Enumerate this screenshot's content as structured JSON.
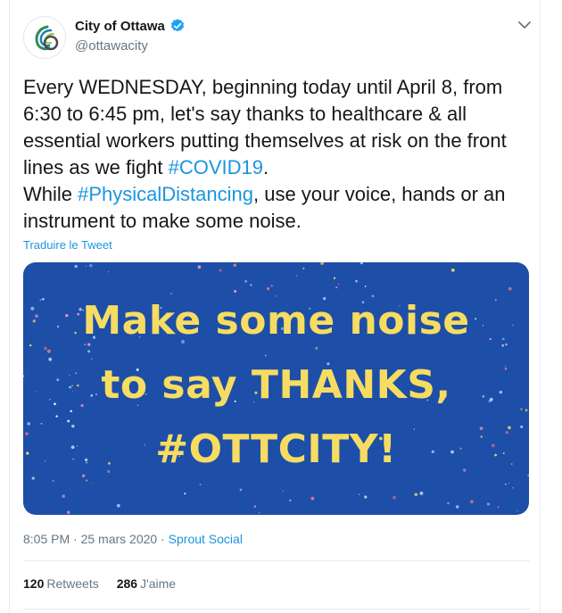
{
  "account": {
    "display_name": "City of Ottawa",
    "handle": "@ottawacity",
    "verified": true
  },
  "tweet": {
    "text_part1": "Every WEDNESDAY, beginning today until April 8, from 6:30 to 6:45 pm, let's say thanks to healthcare & all essential workers putting themselves at risk on the front lines as we fight ",
    "hashtag1": "#COVID19",
    "text_part2": ".",
    "text_part3": "While ",
    "hashtag2": "#PhysicalDistancing",
    "text_part4": ", use your voice, hands or an instrument to make some noise.",
    "translate_label": "Traduire le Tweet"
  },
  "media": {
    "line1": "Make some noise",
    "line2": "to say THANKS,",
    "line3": "#OTTCITY!",
    "background_color": "#1d4ea8",
    "text_color": "#f6dc61"
  },
  "meta": {
    "time": "8:05 PM",
    "separator1": " · ",
    "date": "25 mars 2020",
    "separator2": " · ",
    "source": "Sprout Social"
  },
  "stats": {
    "retweets_count": "120",
    "retweets_label": "Retweets",
    "likes_count": "286",
    "likes_label": "J'aime"
  },
  "colors": {
    "link": "#1b95e0",
    "secondary_text": "#657786",
    "primary_text": "#14171a"
  }
}
